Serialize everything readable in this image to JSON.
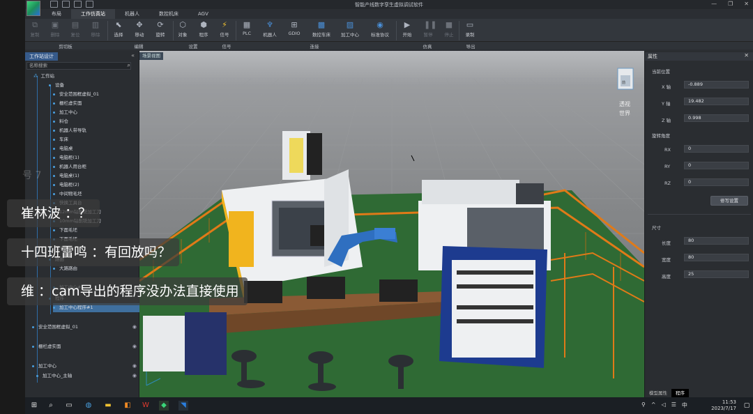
{
  "window": {
    "title": "智能产线数字孪生虚拟调试软件",
    "min": "—",
    "max": "❐",
    "close": "✕"
  },
  "menu_tabs": [
    {
      "label": "布局",
      "active": false
    },
    {
      "label": "工作仿真站",
      "active": true
    },
    {
      "label": "机器人",
      "active": false
    },
    {
      "label": "数控机床",
      "active": false
    },
    {
      "label": "AGV",
      "active": false
    }
  ],
  "ribbon": {
    "copy": "复制",
    "delete": "删除",
    "reset": "复位",
    "remove": "移除",
    "select": "选择",
    "move": "移动",
    "rotate": "旋转",
    "object": "对象",
    "program": "程序",
    "signal": "信号",
    "plc": "PLC",
    "robot": "机器人",
    "gdio": "GDIO",
    "cnc": "数控车床",
    "machining": "加工中心",
    "standard": "标准协议",
    "start": "开始",
    "pause": "暂停",
    "stop": "停止",
    "record": "录制"
  },
  "ribbon_groups": {
    "clipboard": "剪切板",
    "edit": "编辑",
    "set": "设置",
    "signal": "信号",
    "connect": "连接",
    "simulate": "仿真",
    "export": "导出"
  },
  "left_panel": {
    "tab": "工作站设计",
    "collapse": "«",
    "search_placeholder": "名称搜索",
    "tree": [
      {
        "label": "工作站"
      },
      {
        "label": "设备"
      },
      {
        "label": "安全范围框虚拟_01"
      },
      {
        "label": "栅栏虚实面"
      },
      {
        "label": "加工中心"
      },
      {
        "label": "料仓"
      },
      {
        "label": "机器人带导轨"
      },
      {
        "label": "车床"
      },
      {
        "label": "电脑桌"
      },
      {
        "label": "电脑柜(1)"
      },
      {
        "label": "机器人用台柜"
      },
      {
        "label": "电脑桌(1)"
      },
      {
        "label": "电脑柜(2)"
      },
      {
        "label": "中间物毛坯"
      },
      {
        "label": "快换工具台"
      },
      {
        "label": "12mm钻削铣加工刀"
      },
      {
        "label": "10mm钻削铣加工刀"
      },
      {
        "label": "下面毛坯"
      },
      {
        "label": "下面毛坯"
      },
      {
        "label": "信号"
      },
      {
        "label": "路由"
      },
      {
        "label": "大路路由"
      },
      {
        "label": "加工中心#1"
      },
      {
        "label": "程序"
      },
      {
        "label": "加工中心程序#1"
      },
      {
        "label": "安全范围框虚拟_01"
      },
      {
        "label": "栅栏虚实面"
      },
      {
        "label": "加工中心"
      },
      {
        "label": "加工中心_主轴"
      }
    ]
  },
  "viewport": {
    "tab": "场景视图",
    "view_cube": "前",
    "view_mode": "透视",
    "view_space": "世界"
  },
  "properties": {
    "header": "属性",
    "position_label": "当前位置",
    "x_label": "X 轴",
    "x_value": "-0.889",
    "y_label": "Y 轴",
    "y_value": "19.482",
    "z_label": "Z 轴",
    "z_value": "0.998",
    "rotation_label": "旋转角度",
    "rx_label": "RX",
    "rx_value": "0",
    "ry_label": "RY",
    "ry_value": "0",
    "rz_label": "RZ",
    "rz_value": "0",
    "apply_button": "修写设置",
    "size_label": "尺寸",
    "length_label": "长度",
    "length_value": "80",
    "width_label": "宽度",
    "width_value": "80",
    "height_label": "高度",
    "height_value": "25",
    "bottom_tabs": [
      {
        "label": "模型属性",
        "active": false
      },
      {
        "label": "程序",
        "active": true
      }
    ]
  },
  "taskbar": {
    "time": "11:53",
    "date": "2023/7/17"
  },
  "comments": {
    "faded": "号 7",
    "c1": "崔林波 ：？",
    "c2": "十四班雷鸣 ：有回放吗？",
    "c3": "维 ：cam导出的程序没办法直接使用"
  }
}
